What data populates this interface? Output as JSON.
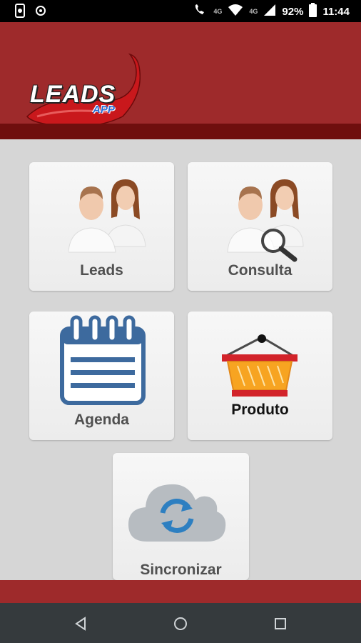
{
  "status_bar": {
    "battery": "92%",
    "time": "11:44",
    "network_1": "4G",
    "network_2": "4G"
  },
  "header": {
    "logo_text": "LEADS",
    "logo_sub": "APP",
    "colors": {
      "primary": "#9e2a2b",
      "strip": "#6f0f0e"
    }
  },
  "menu": {
    "leads": {
      "label": "Leads",
      "icon": "people-icon"
    },
    "consulta": {
      "label": "Consulta",
      "icon": "people-search-icon"
    },
    "agenda": {
      "label": "Agenda",
      "icon": "calendar-icon"
    },
    "produto": {
      "label": "Produto",
      "icon": "basket-icon"
    },
    "sincronizar": {
      "label": "Sincronizar",
      "icon": "cloud-sync-icon"
    }
  },
  "nav": {
    "back": "back-icon",
    "home": "home-icon",
    "recents": "recents-icon"
  }
}
